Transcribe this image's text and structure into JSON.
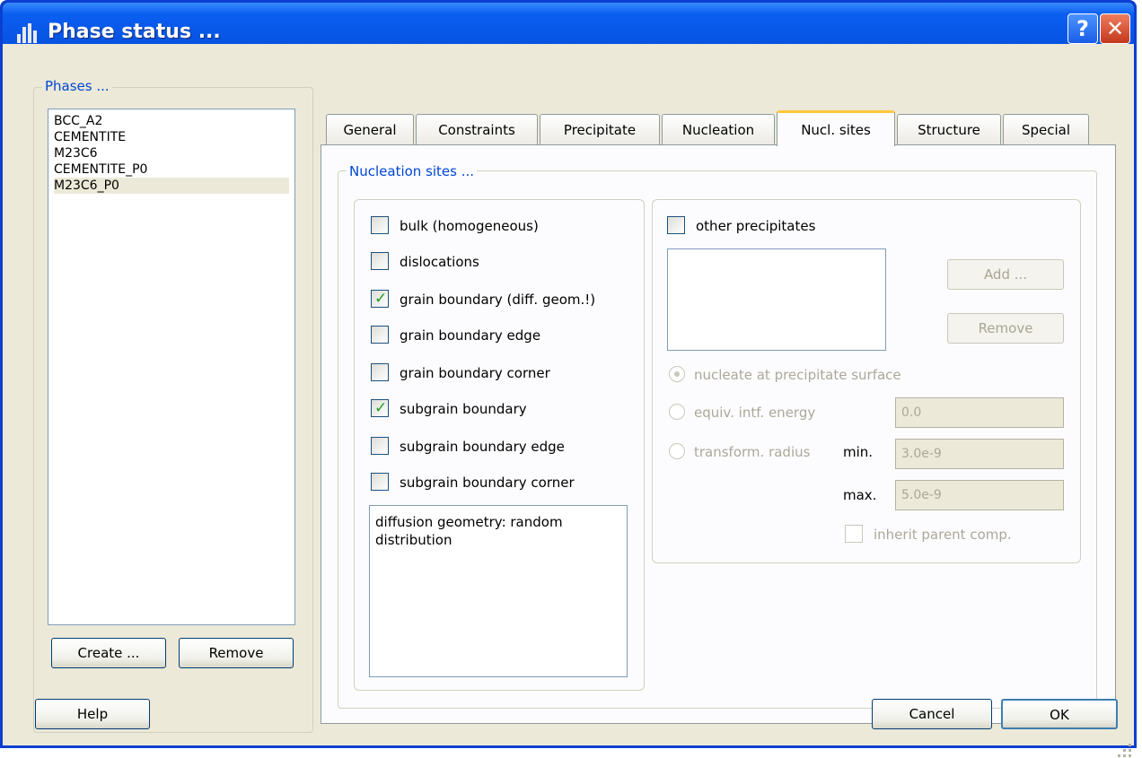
{
  "window": {
    "title": "Phase status ...",
    "help_button": "?",
    "close_button": "✕"
  },
  "phases": {
    "group_label": "Phases ...",
    "items": [
      {
        "label": "BCC_A2"
      },
      {
        "label": "CEMENTITE"
      },
      {
        "label": "M23C6"
      },
      {
        "label": "CEMENTITE_P0"
      },
      {
        "label": "M23C6_P0",
        "selected": true
      }
    ],
    "create_button": "Create ...",
    "remove_button": "Remove"
  },
  "tabs": [
    {
      "label": "General"
    },
    {
      "label": "Constraints"
    },
    {
      "label": "Precipitate"
    },
    {
      "label": "Nucleation"
    },
    {
      "label": "Nucl. sites",
      "active": true
    },
    {
      "label": "Structure"
    },
    {
      "label": "Special"
    }
  ],
  "nucleation_sites": {
    "group_label": "Nucleation sites ...",
    "checkboxes": [
      {
        "label": "bulk (homogeneous)",
        "checked": false
      },
      {
        "label": "dislocations",
        "checked": false
      },
      {
        "label": "grain boundary (diff. geom.!)",
        "checked": true
      },
      {
        "label": "grain boundary edge",
        "checked": false
      },
      {
        "label": "grain boundary corner",
        "checked": false
      },
      {
        "label": "subgrain boundary",
        "checked": true
      },
      {
        "label": "subgrain boundary edge",
        "checked": false
      },
      {
        "label": "subgrain boundary corner",
        "checked": false
      }
    ],
    "checkmark": "✓",
    "diffusion_text": "diffusion geometry: random distribution"
  },
  "other_precipitates": {
    "label": "other precipitates",
    "checked": false,
    "add_button": "Add ...",
    "remove_button": "Remove",
    "radio_nucleate": "nucleate at precipitate surface",
    "radio_equiv": "equiv. intf. energy",
    "equiv_value": "0.0",
    "radio_transform": "transform. radius",
    "min_label": "min.",
    "min_value": "3.0e-9",
    "max_label": "max.",
    "max_value": "5.0e-9",
    "inherit_label": "inherit parent comp."
  },
  "footer": {
    "help_button": "Help",
    "cancel_button": "Cancel",
    "ok_button": "OK"
  },
  "colors": {
    "title_bar": "#0a5ff1",
    "group_label": "#0046d5",
    "active_tab_accent": "#ffc83c",
    "check": "#21a121"
  }
}
